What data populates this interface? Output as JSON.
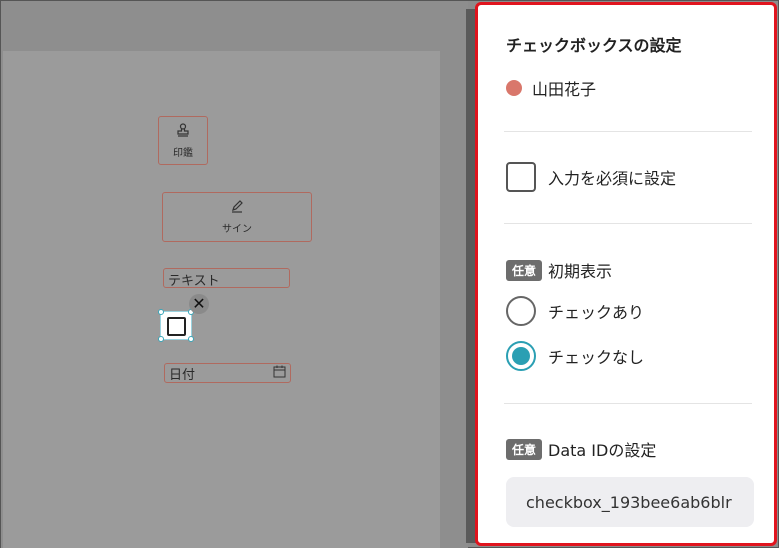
{
  "canvas": {
    "stamp_label": "印鑑",
    "sign_label": "サイン",
    "text_field": "テキスト",
    "date_field": "日付",
    "close_glyph": "✕",
    "stamp_icon": "stamp-icon",
    "sign_icon": "pen-icon",
    "date_icon": "calendar-icon"
  },
  "panel": {
    "title": "チェックボックスの設定",
    "user_name": "山田花子",
    "user_color": "#d9776b",
    "required_label": "入力を必須に設定",
    "required_checked": false,
    "optional_badge": "任意",
    "initial_label": "初期表示",
    "radio_checked": "チェックあり",
    "radio_unchecked": "チェックなし",
    "selected_option": "チェックなし",
    "dataid_badge": "任意",
    "dataid_label": "Data IDの設定",
    "dataid_value": "checkbox_193bee6ab6blr"
  },
  "colors": {
    "accent": "#2a9fb3",
    "highlight_border": "#e0141e",
    "field_border": "#b06a5f"
  }
}
